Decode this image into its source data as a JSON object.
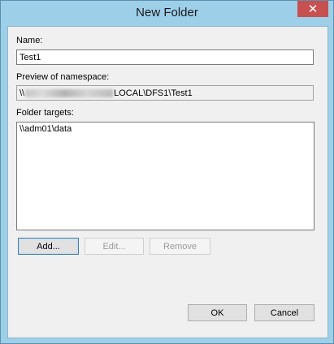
{
  "window": {
    "title": "New Folder",
    "close_glyph": "✕"
  },
  "name_field": {
    "label": "Name:",
    "value": "Test1"
  },
  "preview": {
    "label": "Preview of namespace:",
    "prefix": "\\\\",
    "visible_part": "LOCAL\\DFS1\\Test1"
  },
  "folder_targets": {
    "label": "Folder targets:",
    "items": [
      "\\\\adm01\\data"
    ]
  },
  "buttons": {
    "add": "Add...",
    "edit": "Edit...",
    "remove": "Remove",
    "ok": "OK",
    "cancel": "Cancel"
  },
  "colors": {
    "frame": "#9ecfe9",
    "close": "#c75050",
    "client": "#f0f0f0",
    "default_button_border": "#3c7fb1"
  },
  "icons": {
    "close": "close-icon"
  }
}
